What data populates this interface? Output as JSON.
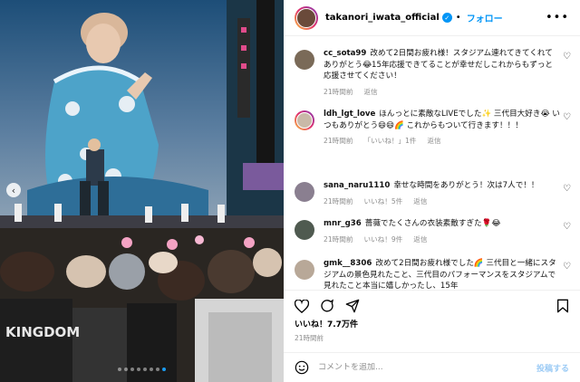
{
  "post": {
    "account": "takanori_iwata_official",
    "follow_label": "フォロー",
    "separator": "•",
    "more_label": "•••",
    "likes_text": "いいね！7.7万件",
    "time_text": "21時間前"
  },
  "photo": {
    "carousel_count": 8,
    "carousel_active": 7,
    "stage_text": "KINGDOM"
  },
  "comments": [
    {
      "user": "cc_sota99",
      "text": "改めて2日間お疲れ様！スタジアム連れてきてくれてありがとう😂15年応援できてることが幸せだしこれからもずっと応援させてください！",
      "time": "21時間前",
      "likes": "",
      "reply": "返信"
    },
    {
      "user": "ldh_lgt_love",
      "text": "ほんっとに素敵なLIVEでした✨ 三代目大好き😭 いつもありがとう😄😄🌈 これからもついて行きます！！！",
      "time": "21時間前",
      "likes": "「いいね！」1件",
      "reply": "返信"
    },
    {
      "user": "sana_naru1110",
      "text": "幸せな時間をありがとう！次は7人で！！",
      "time": "21時間前",
      "likes": "いいね！5件",
      "reply": "返信"
    },
    {
      "user": "mnr_g36",
      "text": "薔薇でたくさんの衣装素敵すぎた🌹😂",
      "time": "21時間前",
      "likes": "いいね！9件",
      "reply": "返信"
    },
    {
      "user": "gmk__8306",
      "text": "改めて2日間お疲れ様でした🌈 三代目と一緒にスタジアムの景色見れたこと、三代目のパフォーマンスをスタジアムで見れたこと本当に嬉しかったし、15年",
      "time": "",
      "likes": "",
      "reply": ""
    }
  ],
  "add_comment": {
    "placeholder": "コメントを追加...",
    "post_label": "投稿する"
  },
  "colors": {
    "accent": "#0095f6",
    "muted": "#8e8e8e"
  }
}
